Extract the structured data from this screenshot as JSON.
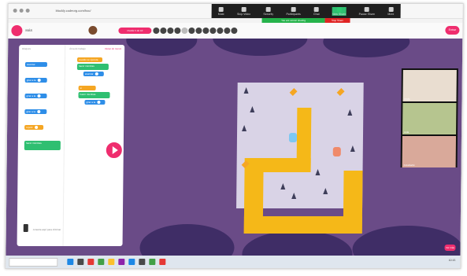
{
  "browser": {
    "url": "blockly.codeorg.com/hoc/"
  },
  "zoom_toolbar": {
    "items": [
      {
        "label": "Mute",
        "icon": "mic-icon"
      },
      {
        "label": "Stop Video",
        "icon": "camera-icon"
      },
      {
        "label": "Security",
        "icon": "shield-icon"
      },
      {
        "label": "Participants",
        "icon": "people-icon"
      },
      {
        "label": "Chat",
        "icon": "chat-icon"
      },
      {
        "label": "New Share",
        "icon": "share-icon"
      },
      {
        "label": "Pause Share",
        "icon": "pause-icon"
      },
      {
        "label": "More",
        "icon": "more-icon"
      }
    ],
    "sharing_notice": "You are screen sharing",
    "stop_share_label": "Stop Share"
  },
  "app_header": {
    "logo_text": "MÁS",
    "level_pill": "Puzzle 5 de 10",
    "right_button": "Entrar"
  },
  "workspace": {
    "toolbox_header": "Bloques",
    "workspace_header": "Área de trabajo",
    "workspace_action": "Iniciar de nuevo",
    "toolbox_blocks": [
      {
        "label": "avanzar",
        "color": "blue"
      },
      {
        "label": "girar a la",
        "color": "blue"
      },
      {
        "label": "girar a la",
        "color": "blue"
      },
      {
        "label": "girar a la",
        "color": "blue"
      },
      {
        "label": "repetir",
        "color": "orange"
      },
      {
        "label": "hacer mientras",
        "color": "green"
      }
    ],
    "program_blocks": [
      {
        "label": "cuando se ejecuta",
        "color": "orange"
      },
      {
        "label": "hacer mientras",
        "color": "green"
      },
      {
        "label": "avanzar",
        "color": "blue"
      },
      {
        "label": "si",
        "color": "orange"
      },
      {
        "label": "hacer mientras",
        "color": "green"
      },
      {
        "label": "girar a la",
        "color": "blue"
      }
    ],
    "trash_text": "Arrastra aquí para eliminar"
  },
  "video_panel": {
    "participants": [
      {
        "name": "Profe"
      },
      {
        "name": "Aula"
      },
      {
        "name": "Estudiante"
      }
    ],
    "more_button": "Ver más"
  },
  "taskbar": {
    "search_placeholder": "",
    "clock": "10:15"
  }
}
